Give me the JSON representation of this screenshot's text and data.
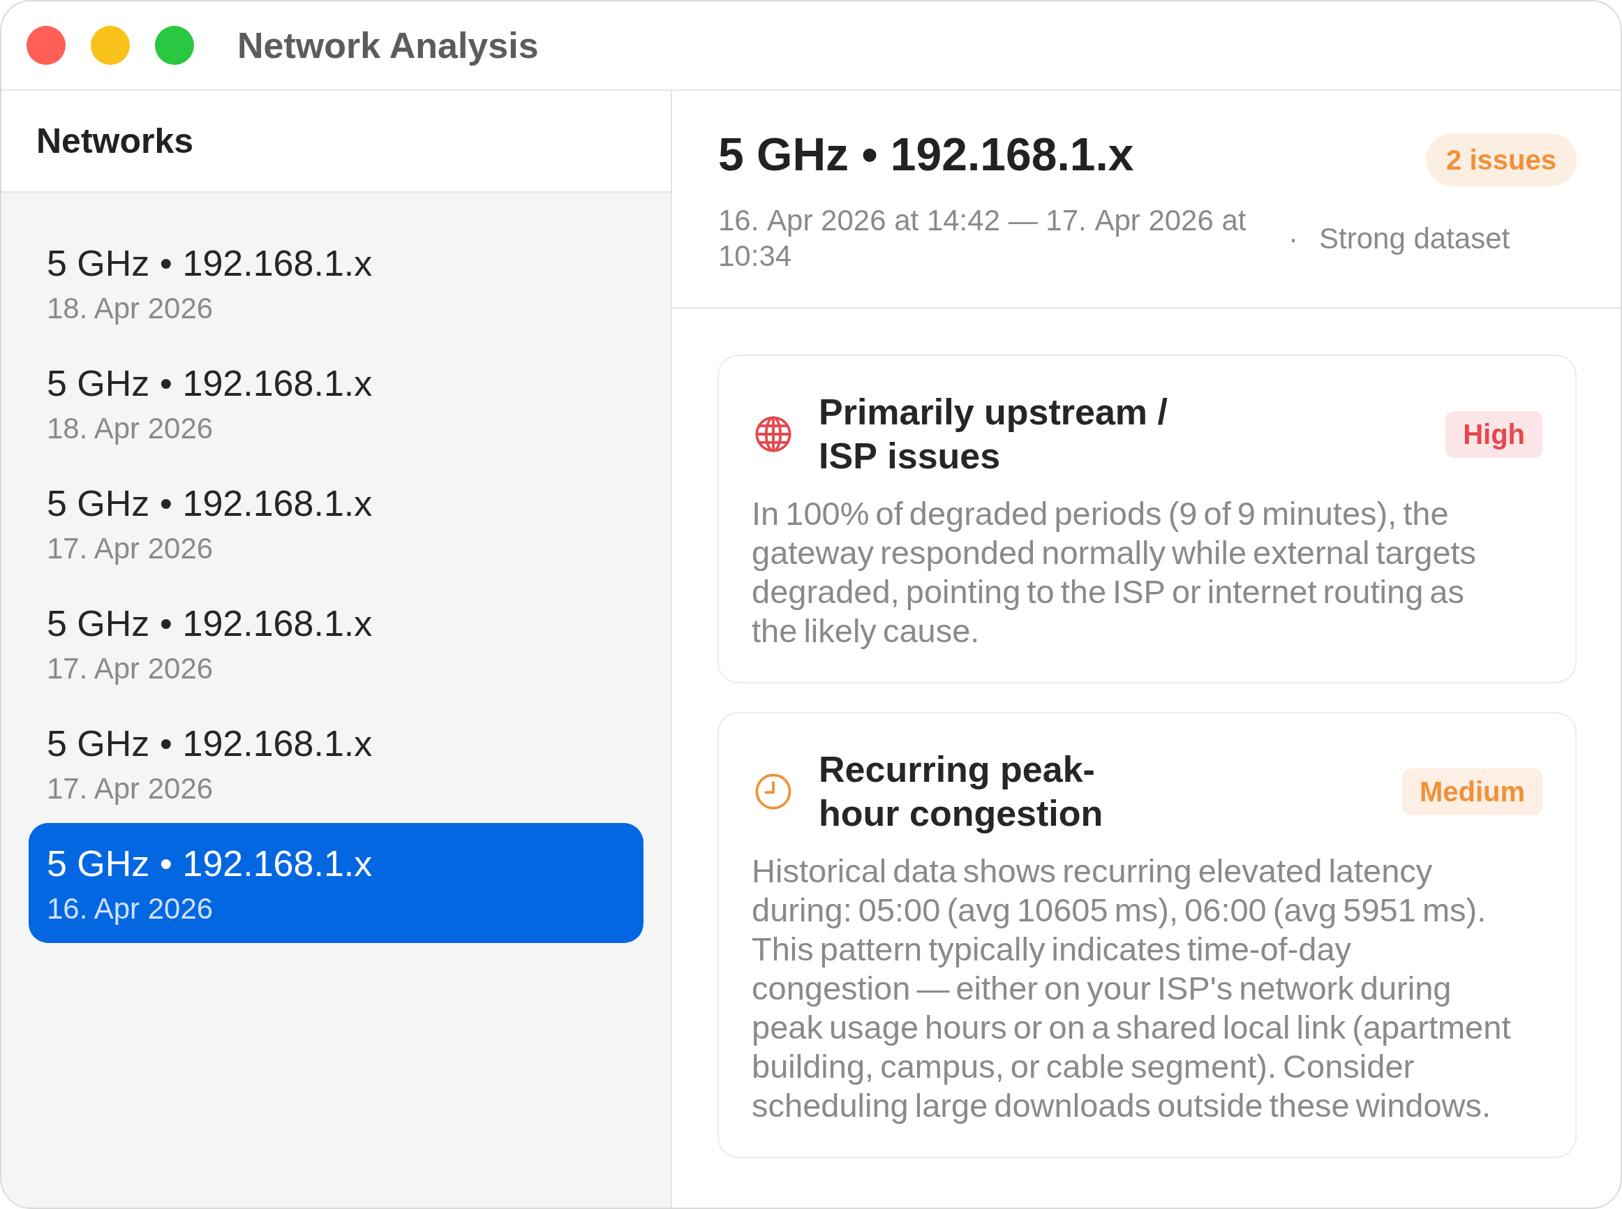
{
  "window": {
    "title": "Network Analysis"
  },
  "sidebar": {
    "title": "Networks",
    "items": [
      {
        "name": "5 GHz • 192.168.1.x",
        "date": "18. Apr 2026",
        "selected": false
      },
      {
        "name": "5 GHz • 192.168.1.x",
        "date": "18. Apr 2026",
        "selected": false
      },
      {
        "name": "5 GHz • 192.168.1.x",
        "date": "17. Apr 2026",
        "selected": false
      },
      {
        "name": "5 GHz • 192.168.1.x",
        "date": "17. Apr 2026",
        "selected": false
      },
      {
        "name": "5 GHz • 192.168.1.x",
        "date": "17. Apr 2026",
        "selected": false
      },
      {
        "name": "5 GHz • 192.168.1.x",
        "date": "16. Apr 2026",
        "selected": true
      }
    ]
  },
  "detail": {
    "title": "5 GHz • 192.168.1.x",
    "issues_badge": "2 issues",
    "time_range": "16. Apr 2026 at 14:42 — 17. Apr 2026 at 10:34",
    "separator": "·",
    "dataset_quality": "Strong dataset",
    "findings": [
      {
        "kind": "upstream",
        "color": "#e5484d",
        "title": "Primarily upstream / ISP issues",
        "severity": "High",
        "description": "In 100% of degraded periods (9 of 9 minutes), the gateway responded normally while external targets degraded, pointing to the ISP or internet routing as the likely cause."
      },
      {
        "kind": "congestion",
        "color": "#f0913a",
        "title": "Recurring peak-hour congestion",
        "severity": "Medium",
        "description": "Historical data shows recurring elevated latency during: 05:00 (avg 10605 ms), 06:00 (avg 5951 ms). This pattern typically indicates time-of-day congestion — either on your ISP's network during peak usage hours or on a shared local link (apartment building, campus, or cable segment). Consider scheduling large downloads outside these windows."
      }
    ]
  }
}
